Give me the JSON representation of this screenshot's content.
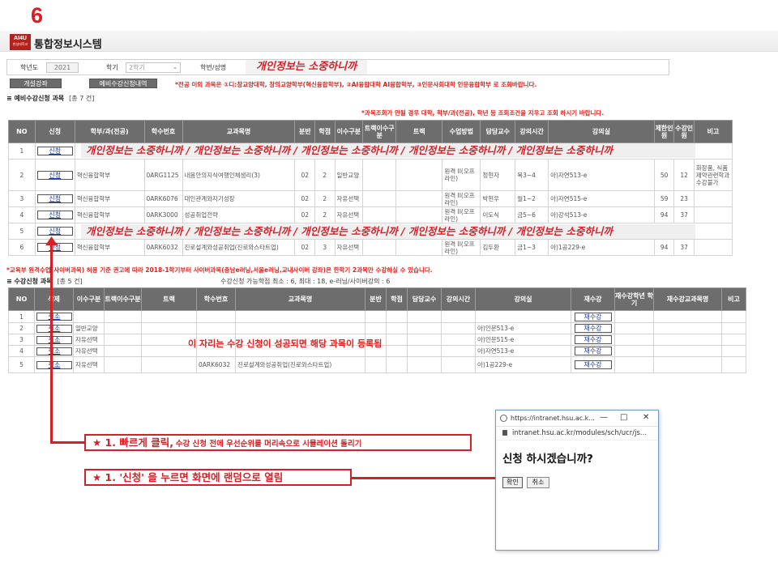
{
  "step_number": "6",
  "header": {
    "logo_text": "AI4U",
    "logo_sub": "한성대학교",
    "app_title": "통합정보시스템"
  },
  "search": {
    "year_label": "학년도",
    "year_value": "2021",
    "term_label": "학기",
    "term_value": "2학기",
    "id_label": "학번/성명",
    "redacted_text": "개인정보는 소중하니까"
  },
  "buttons": {
    "open_courses": "개설강좌",
    "pre_list": "예비수강신청내역"
  },
  "notes": {
    "major_note": "*전공 이외 과목은 ①디:창교양대학, 창의교양학부(혁신융합학부), ②AI융합대학 AI융합학부, ③인문사회대학 인문융합학부 로 조회바랍니다.",
    "search_tip": "*과목조회가 안될 경우 대학, 학부/과(전공), 학년 등 조회조건을 지우고 조회 하시기 바랍니다.",
    "remote_note": "*교육부 원격수업(사이버과목) 허용 기준 권고에 따라 2018-1학기부터 사이버과목(충남e러닝,서울e러닝,교내사이버 강좌)은 한학기 2과목만 수강하실 수 있습니다.",
    "credit_info": "수강신청 가능학점 최소 : 6, 최대 : 18, e-러닝/사이버강의 : 6",
    "center_note": "이 자리는 수강 신청이 성공되면 해당 과목이 등록됨"
  },
  "pre_section": {
    "title": "예비수강신청 과목",
    "count": "[총      7 건]"
  },
  "pre_table": {
    "headers": [
      "NO",
      "신청",
      "학부/과(전공)",
      "학수번호",
      "교과목명",
      "분반",
      "학점",
      "이수구분",
      "트랙이수구분",
      "트랙",
      "수업방법",
      "담당교수",
      "강의시간",
      "강의실",
      "제한인원",
      "수강인원",
      "비고"
    ],
    "apply_label": "신청",
    "redacted_text": "개인정보는 소중하니까  /  개인정보는 소중하니까  /  개인정보는 소중하니까  / 개인정보는 소중하니까  / 개인정보는 소중하니까",
    "rows": [
      {
        "no": "1",
        "redacted": true
      },
      {
        "no": "2",
        "dept": "혁신융합학부",
        "code": "0ARG1125",
        "course": "내몸안의지식여행인체생리(3)",
        "sec": "02",
        "credit": "2",
        "type": "일반교양",
        "track_type": "",
        "track": "",
        "method": "원격 II(오프라인)",
        "prof": "정현자",
        "time": "목3~4",
        "room": "아)자연513-e",
        "limit": "50",
        "enrolled": "12",
        "note": "화장품, 식품제약관련학과 수강불가"
      },
      {
        "no": "3",
        "dept": "혁신융합학부",
        "code": "0ARK6076",
        "course": "대인관계와자기성장",
        "sec": "02",
        "credit": "2",
        "type": "자유선택",
        "track_type": "",
        "track": "",
        "method": "원격 II(오프라인)",
        "prof": "박현우",
        "time": "월1~2",
        "room": "아)자연515-e",
        "limit": "59",
        "enrolled": "23",
        "note": ""
      },
      {
        "no": "4",
        "dept": "혁신융합학부",
        "code": "0ARK3000",
        "course": "성공취업전략",
        "sec": "02",
        "credit": "2",
        "type": "자유선택",
        "track_type": "",
        "track": "",
        "method": "원격 II(오프라인)",
        "prof": "이도식",
        "time": "금5~6",
        "room": "아)강석513-e",
        "limit": "94",
        "enrolled": "37",
        "note": ""
      },
      {
        "no": "5",
        "redacted": true
      },
      {
        "no": "6",
        "dept": "혁신융합학부",
        "code": "0ARK6032",
        "course": "진로설계와성공취업(진로와스타트업)",
        "sec": "02",
        "credit": "3",
        "type": "자유선택",
        "track_type": "",
        "track": "",
        "method": "원격 II(오프라인)",
        "prof": "김두환",
        "time": "금1~3",
        "room": "아)1공229-e",
        "limit": "94",
        "enrolled": "37",
        "note": ""
      }
    ]
  },
  "enrolled_section": {
    "title": "수강신청 과목",
    "count": "[총      5 건]"
  },
  "enrolled_table": {
    "headers": [
      "NO",
      "삭제",
      "이수구분",
      "트랙이수구분",
      "트랙",
      "학수번호",
      "교과목명",
      "분반",
      "학점",
      "담당교수",
      "강의시간",
      "강의실",
      "재수강",
      "재수강학년 학기",
      "재수강교과목명",
      "비고"
    ],
    "cancel_label": "취소",
    "retake_label": "재수강",
    "rows": [
      {
        "no": "1",
        "type": "",
        "code": "",
        "course": "",
        "room": ""
      },
      {
        "no": "2",
        "type": "일반교양",
        "code": "",
        "course": "",
        "room": "아)인문513-e"
      },
      {
        "no": "3",
        "type": "자유선택",
        "code": "",
        "course": "",
        "room": "아)인문515-e"
      },
      {
        "no": "4",
        "type": "자유선택",
        "code": "",
        "course": "",
        "room": "아)자연513-e"
      },
      {
        "no": "5",
        "type": "자유선택",
        "code": "0ARK6032",
        "course": "진로설계와성공취업(진로와스타트업)",
        "room": "아)1공229-e"
      }
    ]
  },
  "callouts": {
    "c1_big": "★ 1. 빠르게 클릭,",
    "c1_small": "수강 신청 전에 우선순위를 머리속으로 시뮬레이션 돌리기",
    "c2_big": "★ 1.  '신청' 을 누르면 화면에 랜덤으로 열림"
  },
  "popup": {
    "title_url": "https://intranet.hsu.ac.k...",
    "address": "intranet.hsu.ac.kr/modules/sch/ucr/js...",
    "question": "신청 하시겠습니까?",
    "ok": "확인",
    "cancel": "취소",
    "window_buttons": [
      "—",
      "□",
      "✕"
    ]
  },
  "colors": {
    "accent_red": "#d71f26",
    "header_gray": "#6d6d6d",
    "popup_border": "#6f9bd8"
  }
}
